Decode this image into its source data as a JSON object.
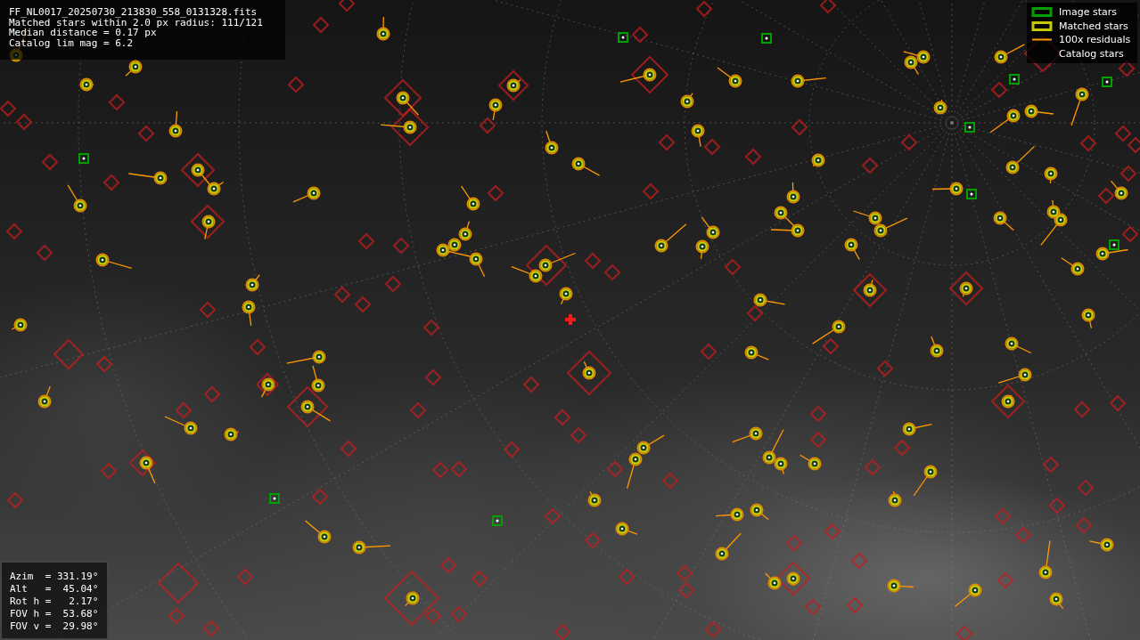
{
  "info_box": {
    "lines": [
      "FF_NL0017_20250730_213830_558_0131328.fits",
      "Matched stars within 2.0 px radius: 111/121",
      "Median distance = 0.17 px",
      "Catalog lim mag = 6.2"
    ]
  },
  "legend": {
    "items": [
      {
        "kind": "box",
        "label": "Image stars",
        "color": "#00a000"
      },
      {
        "kind": "box",
        "label": "Matched stars",
        "color": "#c8c800"
      },
      {
        "kind": "line",
        "label": "100x residuals",
        "color": "#ff9900"
      },
      {
        "kind": "none",
        "label": "Catalog stars"
      }
    ]
  },
  "pointing": {
    "lines": [
      "Azim  = 331.19°",
      "Alt   =  45.04°",
      "Rot h =   2.17°",
      "FOV h =  53.68°",
      "FOV v =  29.98°"
    ]
  }
}
